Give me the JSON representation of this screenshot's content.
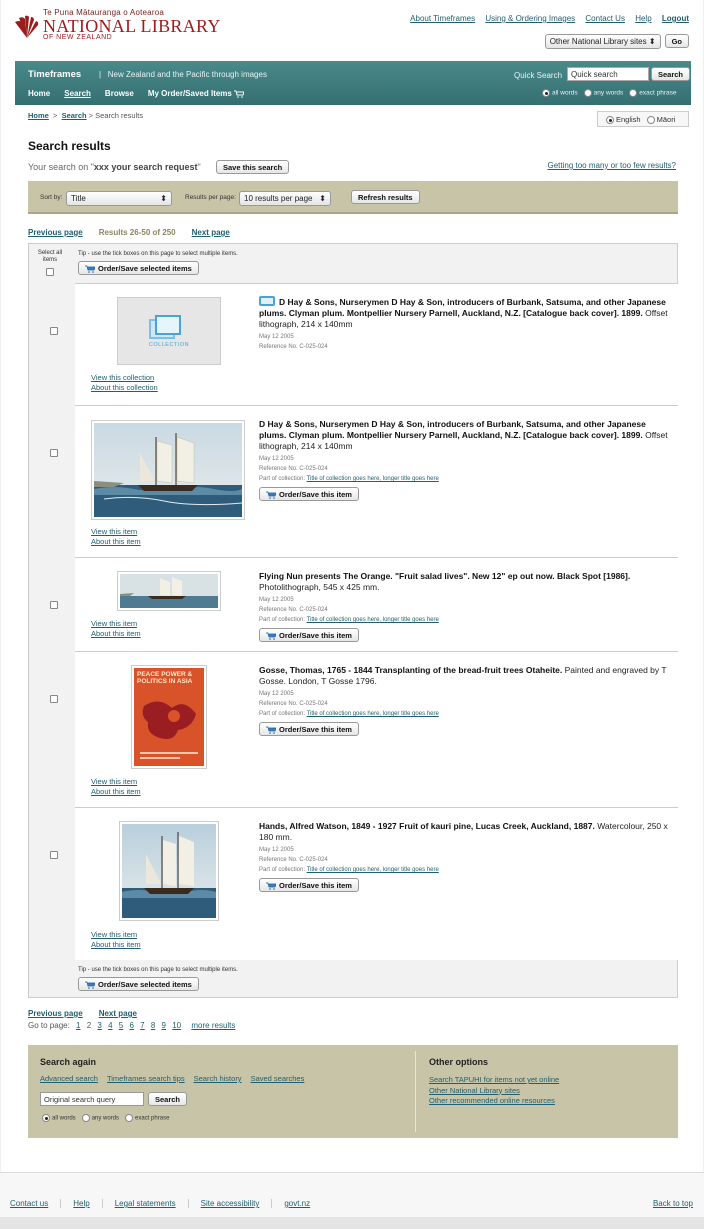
{
  "logo": {
    "maori": "Te Puna Mātauranga o Aotearoa",
    "name": "NATIONAL LIBRARY",
    "sub": "OF NEW ZEALAND"
  },
  "toplinks": [
    "About Timeframes",
    "Using & Ordering Images",
    "Contact Us",
    "Help",
    "Logout"
  ],
  "other_sites": {
    "select": "Other National Library sites",
    "go": "Go"
  },
  "nav": {
    "title": "Timeframes",
    "separator": "|",
    "tagline": "New Zealand and the Pacific through images",
    "menu": [
      "Home",
      "Search",
      "Browse",
      "My Order/Saved Items"
    ],
    "quick_search_label": "Quick Search",
    "quick_search_value": "Quick search",
    "search_btn": "Search",
    "radios": [
      "all words",
      "any words",
      "exact phrase"
    ]
  },
  "crumbs": {
    "home": "Home",
    "search": "Search",
    "current": "Search results"
  },
  "lang": {
    "english": "English",
    "maori": "Māori"
  },
  "title": "Search results",
  "yoursearch": {
    "prefix": "Your search on \"",
    "query": "xxx your search request",
    "suffix": "\""
  },
  "save_search": "Save this search",
  "too_many": "Getting too many or too few results?",
  "sort": {
    "sort_label": "Sort by:",
    "sort_value": "Title",
    "per_page_label": "Results per page:",
    "per_page_value": "10 results per page",
    "refresh": "Refresh results"
  },
  "pager": {
    "prev": "Previous page",
    "count": "Results 26-50 of 250",
    "next": "Next page"
  },
  "results": {
    "select_all": "Select all items",
    "tip": "Tip - use the tick boxes on this page to select multiple items.",
    "order_selected": "Order/Save selected items",
    "items": [
      {
        "title": "D Hay & Sons, Nurserymen D Hay & Son, introducers of Burbank, Satsuma, and other Japanese plums. Clyman plum. Montpellier Nursery Parnell, Auckland, N.Z. [Catalogue back cover]. 1899.",
        "desc": " Offset lithograph, 214 x 140mm",
        "date": "May 12 2005",
        "ref": "Reference No. C-025-024",
        "thumb_label": "COLLECTION",
        "link1": "View this collection",
        "link2": "About this collection"
      },
      {
        "title": "D Hay & Sons, Nurserymen D Hay & Son, introducers of Burbank, Satsuma, and other Japanese plums. Clyman plum. Montpellier Nursery Parnell, Auckland, N.Z. [Catalogue back cover]. 1899.",
        "desc": " Offset lithograph, 214 x 140mm",
        "date": "May 12 2005",
        "ref": "Reference No. C-025-024",
        "part_prefix": "Part of collection: ",
        "part_link": "Title of collection goes here, longer title goes here",
        "order": "Order/Save this item",
        "link1": "View this item",
        "link2": "About this item"
      },
      {
        "title": "Flying Nun presents The Orange. \"Fruit salad lives\". New 12\" ep out now. Black Spot [1986].",
        "desc": " Photolithograph, 545 x 425 mm.",
        "date": "May 12 2005",
        "ref": "Reference No. C-025-024",
        "part_prefix": "Part of collection: ",
        "part_link": "Title of collection goes here, longer title goes here",
        "order": "Order/Save this item",
        "link1": "View this item",
        "link2": "About this item"
      },
      {
        "title": "Gosse, Thomas, 1765 - 1844 Transplanting of the bread-fruit trees Otaheite.",
        "desc": " Painted and engraved by T Gosse. London, T Gosse 1796.",
        "date": "May 12 2005",
        "ref": "Reference No. C-025-024",
        "part_prefix": "Part of collection: ",
        "part_link": "Title of collection goes here, longer title goes here",
        "order": "Order/Save this item",
        "poster_text": "PEACE POWER & POLITICS IN ASIA",
        "link1": "View this item",
        "link2": "About this item"
      },
      {
        "title": "Hands, Alfred Watson, 1849 - 1927 Fruit of kauri pine, Lucas Creek, Auckland, 1887.",
        "desc": " Watercolour, 250 x 180 mm.",
        "date": "May 12 2005",
        "ref": "Reference No. C-025-024",
        "part_prefix": "Part of collection: ",
        "part_link": "Title of collection goes here, longer title goes here",
        "order": "Order/Save this item",
        "link1": "View this item",
        "link2": "About this item"
      }
    ]
  },
  "pager2": {
    "prev": "Previous page",
    "next": "Next page",
    "goto": "Go to page:",
    "pages": [
      "1",
      "2",
      "3",
      "4",
      "5",
      "6",
      "7",
      "8",
      "9",
      "10"
    ],
    "more": "more results"
  },
  "search_again": {
    "title": "Search again",
    "links": [
      "Advanced search",
      "Timeframes search tips",
      "Search history",
      "Saved searches"
    ],
    "query": "Original search query",
    "btn": "Search",
    "radios": [
      "all words",
      "any words",
      "exact phrase"
    ]
  },
  "other_options": {
    "title": "Other options",
    "links": [
      "Search TAPUHI for items not yet online",
      "Other National Library sites",
      "Other recommended online resources"
    ]
  },
  "footer": {
    "links": [
      "Contact us",
      "Help",
      "Legal statements",
      "Site accessibility",
      "govt.nz"
    ],
    "back_to_top": "Back to top"
  }
}
